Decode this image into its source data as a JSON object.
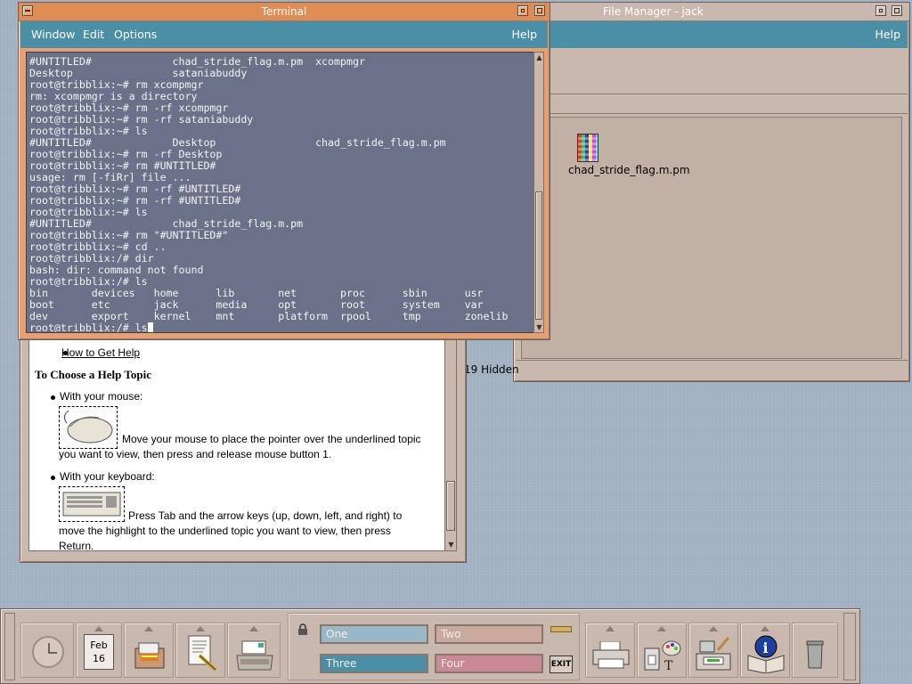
{
  "file_manager": {
    "title": "File Manager - jack",
    "help_menu": "Help",
    "file_name": "chad_stride_flag.m.pm",
    "status": "19 Hidden"
  },
  "terminal": {
    "title": "Terminal",
    "menu": [
      "Window",
      "Edit",
      "Options"
    ],
    "help_menu": "Help",
    "lines": [
      "#UNTITLED#             chad_stride_flag.m.pm  xcompmgr",
      "Desktop                sataniabuddy",
      "root@tribblix:~# rm xcompmgr",
      "rm: xcompmgr is a directory",
      "root@tribblix:~# rm -rf xcompmgr",
      "root@tribblix:~# rm -rf sataniabuddy",
      "root@tribblix:~# ls",
      "#UNTITLED#             Desktop                chad_stride_flag.m.pm",
      "root@tribblix:~# rm -rf Desktop",
      "root@tribblix:~# rm #UNTITLED#",
      "usage: rm [-fiRr] file ...",
      "root@tribblix:~# rm -rf #UNTITLED#",
      "root@tribblix:~# rm -rf #UNTITLED#",
      "root@tribblix:~# ls",
      "#UNTITLED#             chad_stride_flag.m.pm",
      "root@tribblix:~# rm \"#UNTITLED#\"",
      "root@tribblix:~# cd ..",
      "root@tribblix:/# dir",
      "bash: dir: command not found",
      "root@tribblix:/# ls",
      "bin       devices   home      lib       net       proc      sbin      usr",
      "boot      etc       jack      media     opt       root      system    var",
      "dev       export    kernel    mnt       platform  rpool     tmp       zonelib"
    ],
    "prompt": "root@tribblix:/# ls"
  },
  "help_viewer": {
    "link": "How to Get Help",
    "heading": "To Choose a Help Topic",
    "mouse_label": "With your mouse:",
    "mouse_text_1": "Move your mouse to place the pointer over the underlined topic",
    "mouse_text_2": "you want to view, then press and release mouse button 1.",
    "keyboard_label": "With your keyboard:",
    "keyboard_text_1": "Press Tab and the arrow keys (up, down, left, and right) to",
    "keyboard_text_2": "move the highlight to the underlined topic you want to view, then press",
    "keyboard_text_3": "Return."
  },
  "front_panel": {
    "date_month": "Feb",
    "date_day": "16",
    "workspaces": [
      "One",
      "Two",
      "Three",
      "Four"
    ],
    "exit_label": "EXIT"
  },
  "colors": {
    "window_frame": "#cbb9ae",
    "active_title": "#e08c55",
    "menubar": "#4a8fa6",
    "terminal_bg": "#6a7189",
    "desktop": "#a3b3c4",
    "ws_one": "#98b8c8",
    "ws_two": "#c9a99c",
    "ws_three": "#4a8fa6",
    "ws_four": "#c88895"
  }
}
